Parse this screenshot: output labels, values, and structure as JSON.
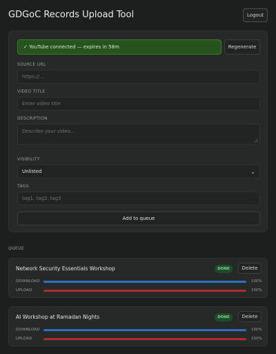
{
  "header": {
    "title": "GDGoC Records Upload Tool",
    "logout_label": "Logout"
  },
  "form": {
    "status_text": "✓ YouTube connected — expires in 58m",
    "regenerate_label": "Regenerate",
    "source_url": {
      "label": "SOURCE URL",
      "placeholder": "https://..."
    },
    "video_title": {
      "label": "VIDEO TITLE",
      "placeholder": "Enter video title"
    },
    "description": {
      "label": "DESCRIPTION",
      "placeholder": "Describe your video..."
    },
    "visibility": {
      "label": "VISIBILITY",
      "value": "Unlisted"
    },
    "tags": {
      "label": "TAGS",
      "placeholder": "tag1, tag2, tag3"
    },
    "add_label": "Add to queue"
  },
  "queue": {
    "heading": "QUEUE",
    "items": [
      {
        "title": "Network Security Essentials Workshop",
        "status": "DONE",
        "delete_label": "Delete",
        "download": {
          "label": "DOWNLOAD",
          "percent": 100,
          "percent_text": "100%"
        },
        "upload": {
          "label": "UPLOAD",
          "percent": 100,
          "percent_text": "100%"
        }
      },
      {
        "title": "AI Workshop at Ramadan Nights",
        "status": "DONE",
        "delete_label": "Delete",
        "download": {
          "label": "DOWNLOAD",
          "percent": 100,
          "percent_text": "100%"
        },
        "upload": {
          "label": "UPLOAD",
          "percent": 100,
          "percent_text": "100%"
        }
      }
    ]
  },
  "colors": {
    "download_bar": "#2f6ec0",
    "upload_bar": "#b52a2a",
    "connected_banner": "#27541e",
    "done_badge": "#1f4a2b"
  }
}
